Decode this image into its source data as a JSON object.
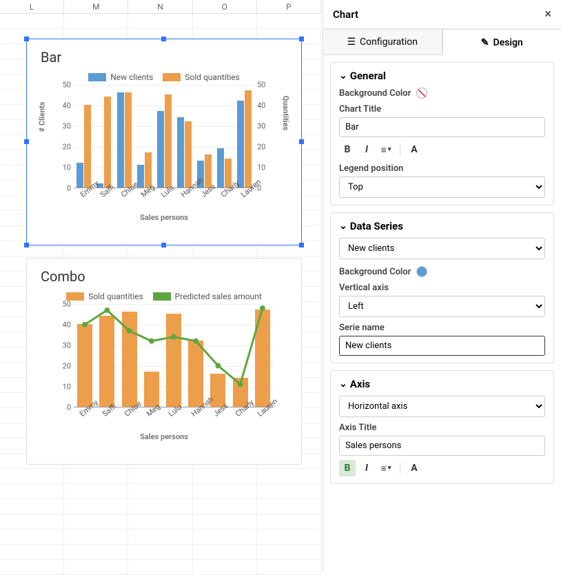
{
  "columns": [
    "L",
    "M",
    "N",
    "O",
    "P"
  ],
  "panel": {
    "title": "Chart",
    "tabs": {
      "config": "Configuration",
      "design": "Design"
    },
    "general": {
      "heading": "General",
      "bg_label": "Background Color",
      "chart_title_label": "Chart Title",
      "chart_title_value": "Bar",
      "legend_pos_label": "Legend position",
      "legend_pos_value": "Top"
    },
    "dataseries": {
      "heading": "Data Series",
      "series_value": "New clients",
      "bg_label": "Background Color",
      "vaxis_label": "Vertical axis",
      "vaxis_value": "Left",
      "serie_name_label": "Serie name",
      "serie_name_value": "New clients"
    },
    "axis": {
      "heading": "Axis",
      "axis_value": "Horizontal axis",
      "axis_title_label": "Axis Title",
      "axis_title_value": "Sales persons"
    }
  },
  "chart_data": [
    {
      "type": "bar",
      "title": "Bar",
      "xlabel": "Sales persons",
      "ylabel": "# Clients",
      "y2label": "Quantities",
      "ylim": [
        0,
        50
      ],
      "y2lim": [
        0,
        50
      ],
      "categories": [
        "Emmy",
        "Saffi",
        "Chloe",
        "Meg",
        "Lulu",
        "Hannah",
        "Jess",
        "Charly",
        "Lauren"
      ],
      "series": [
        {
          "name": "New clients",
          "color": "#5b9bd5",
          "axis": "left",
          "values": [
            12,
            2,
            46,
            11,
            37,
            34,
            13,
            19,
            42
          ]
        },
        {
          "name": "Sold quantities",
          "color": "#ed9e4a",
          "axis": "right",
          "values": [
            40,
            44,
            46,
            17,
            45,
            32,
            16,
            14,
            47
          ]
        }
      ],
      "legend_position": "top"
    },
    {
      "type": "combo",
      "title": "Combo",
      "xlabel": "Sales persons",
      "ylim": [
        0,
        50
      ],
      "categories": [
        "Emmy",
        "Saffi",
        "Chloe",
        "Meg",
        "Lulu",
        "Hannah",
        "Jess",
        "Charly",
        "Lauren"
      ],
      "series": [
        {
          "name": "Sold quantities",
          "kind": "bar",
          "color": "#ed9e4a",
          "values": [
            40,
            44,
            46,
            17,
            45,
            32,
            16,
            14,
            47
          ]
        },
        {
          "name": "Predicted sales amount",
          "kind": "line",
          "color": "#5fa641",
          "values": [
            40,
            47,
            37,
            32,
            34,
            32,
            20,
            11,
            48
          ]
        }
      ],
      "legend_position": "top"
    }
  ]
}
